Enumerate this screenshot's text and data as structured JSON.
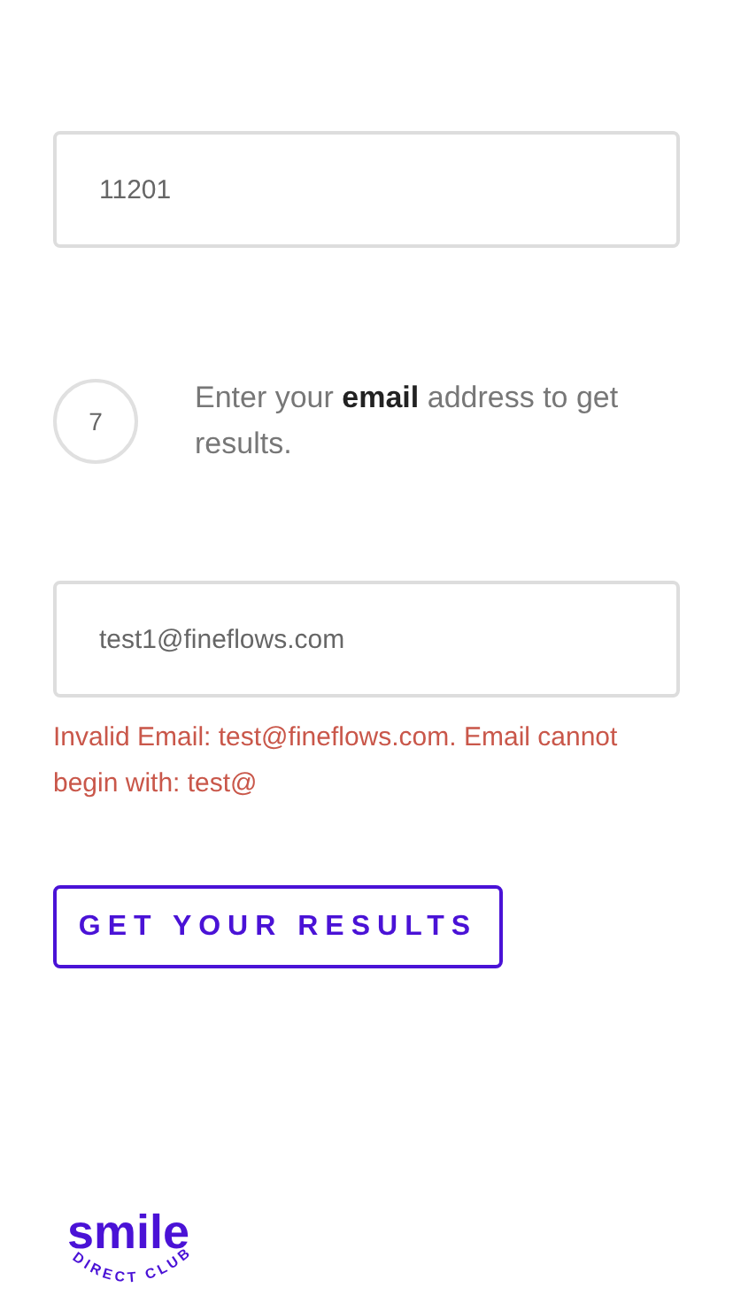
{
  "zip_field": {
    "value": "11201"
  },
  "step": {
    "number": "7",
    "prompt": "Enter your **email** address to get results."
  },
  "email_field": {
    "value": "test1@fineflows.com"
  },
  "error": "Invalid Email: test@fineflows.com. Email cannot begin with: test@",
  "submit_button": "GET YOUR RESULTS",
  "logo": {
    "word": "smile",
    "tagline": "DIRECT CLUB"
  }
}
